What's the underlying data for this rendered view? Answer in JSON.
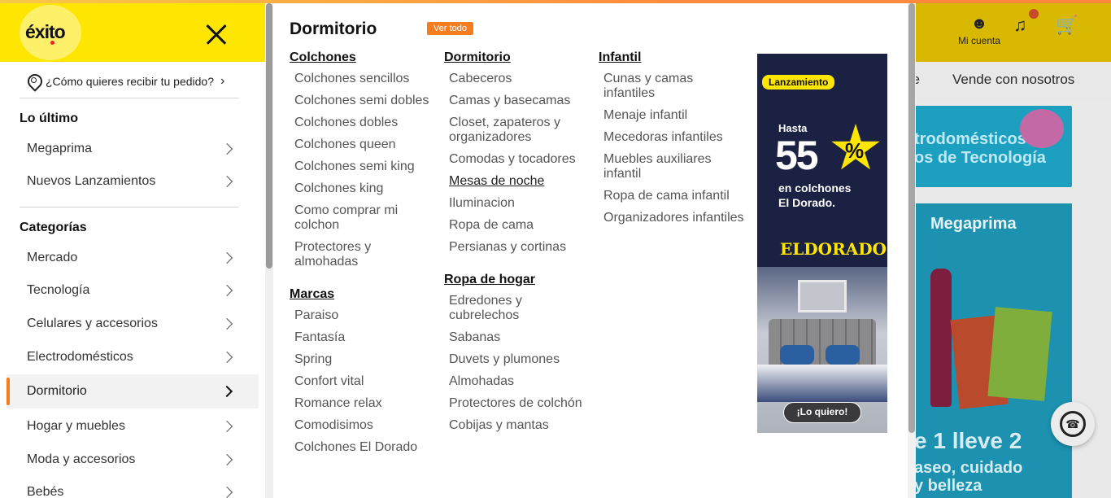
{
  "sidebar": {
    "logo": "éxito",
    "delivery_prompt": "¿Cómo quieres recibir tu pedido?",
    "section_latest": "Lo último",
    "latest_items": [
      {
        "label": "Megaprima"
      },
      {
        "label": "Nuevos Lanzamientos"
      }
    ],
    "section_categories": "Categorías",
    "categories": [
      {
        "label": "Mercado"
      },
      {
        "label": "Tecnología"
      },
      {
        "label": "Celulares y accesorios"
      },
      {
        "label": "Electrodomésticos"
      },
      {
        "label": "Dormitorio",
        "active": true
      },
      {
        "label": "Hogar y muebles"
      },
      {
        "label": "Moda y accesorios"
      },
      {
        "label": "Bebés"
      }
    ]
  },
  "panel": {
    "title": "Dormitorio",
    "see_all": "Ver todo",
    "columns": [
      {
        "groups": [
          {
            "heading": "Colchones",
            "links": [
              "Colchones sencillos",
              "Colchones semi dobles",
              "Colchones dobles",
              "Colchones queen",
              "Colchones semi king",
              "Colchones king",
              "Como comprar mi colchon",
              "Protectores y almohadas"
            ]
          },
          {
            "heading": "Marcas",
            "links": [
              "Paraiso",
              "Fantasía",
              "Spring",
              "Confort vital",
              "Romance relax",
              "Comodisimos",
              "Colchones El Dorado"
            ]
          }
        ]
      },
      {
        "groups": [
          {
            "heading": "Dormitorio",
            "links": [
              "Cabeceros",
              "Camas y basecamas",
              "Closet, zapateros y organizadores",
              "Comodas y tocadores",
              "Mesas de noche",
              "Iluminacion",
              "Ropa de cama",
              "Persianas y cortinas"
            ]
          },
          {
            "heading": "Ropa de hogar",
            "links": [
              "Edredones y cubrelechos",
              "Sabanas",
              "Duvets y plumones",
              "Almohadas",
              "Protectores de colchón",
              "Cobijas y mantas"
            ]
          }
        ]
      },
      {
        "groups": [
          {
            "heading": "Infantil",
            "links": [
              "Cunas y camas infantiles",
              "Menaje infantil",
              "Mecedoras infantiles",
              "Muebles auxiliares infantil",
              "Ropa de cama infantil",
              "Organizadores infantiles"
            ]
          }
        ]
      }
    ],
    "ad": {
      "badge": "Lanzamiento",
      "hasta": "Hasta",
      "number": "55",
      "percent": "%",
      "subtitle_line1": "en colchones",
      "subtitle_line2": "El Dorado.",
      "brand": "ELDORADO",
      "cta": "¡Lo quiero!"
    }
  },
  "background_page": {
    "account_label": "Mi cuenta",
    "nav_partial": "ge",
    "nav_sell": "Vende con nosotros",
    "banner1_text": "trodomésticos",
    "banner1_text2": "os de Tecnología",
    "banner2_title": "Megaprima",
    "banner2_promo": "e 1 lleve 2",
    "banner2_promo2": "aseo, cuidado",
    "banner2_promo3": "y belleza"
  }
}
